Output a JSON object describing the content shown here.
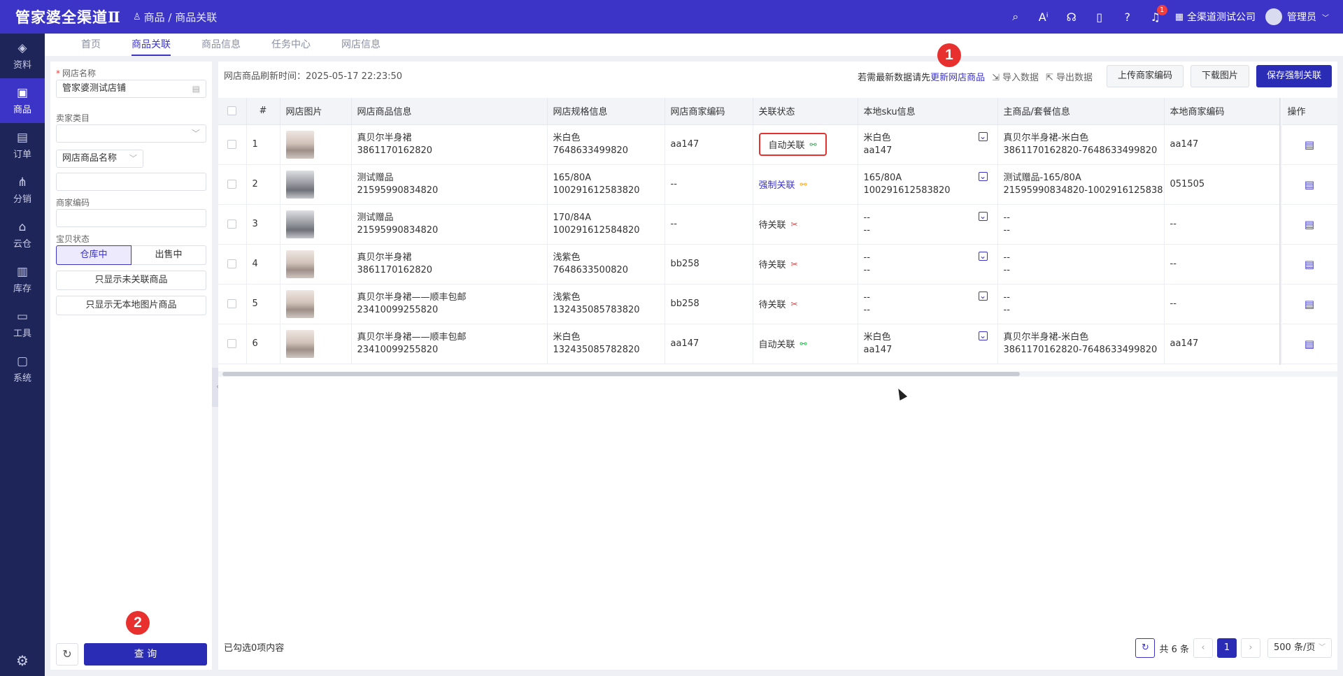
{
  "app": {
    "logo": "管家婆全渠道Ⅱ",
    "breadcrumb": "商品 / 商品关联"
  },
  "topbar": {
    "company": "全渠道测试公司",
    "user": "管理员",
    "notification_count": "1"
  },
  "sidebar": {
    "items": [
      {
        "label": "资料",
        "icon": "layers-icon"
      },
      {
        "label": "商品",
        "icon": "box-icon",
        "active": true
      },
      {
        "label": "订单",
        "icon": "document-icon"
      },
      {
        "label": "分销",
        "icon": "network-icon"
      },
      {
        "label": "云仓",
        "icon": "house-icon"
      },
      {
        "label": "库存",
        "icon": "clipboard-icon"
      },
      {
        "label": "工具",
        "icon": "toolbox-icon"
      },
      {
        "label": "系统",
        "icon": "monitor-icon"
      }
    ]
  },
  "tabs": [
    "首页",
    "商品关联",
    "商品信息",
    "任务中心",
    "网店信息"
  ],
  "filter": {
    "shop_label": "网店名称",
    "shop_value": "管家婆测试店铺",
    "category_label": "卖家类目",
    "category_value": "",
    "name_select": "网店商品名称",
    "name_value": "",
    "code_label": "商家编码",
    "code_value": "",
    "status_label": "宝贝状态",
    "status_options": [
      "仓库中",
      "出售中"
    ],
    "btn_unlinked": "只显示未关联商品",
    "btn_no_image": "只显示无本地图片商品",
    "query": "查 询"
  },
  "toolbar": {
    "refresh_time": "网店商品刷新时间：2025-05-17 22:23:50",
    "hint": "若需最新数据请先",
    "hint_link": "更新网店商品",
    "import": "导入数据",
    "export": "导出数据",
    "upload_code": "上传商家编码",
    "download_image": "下载图片",
    "save_force": "保存强制关联"
  },
  "table": {
    "headers": [
      "#",
      "网店图片",
      "网店商品信息",
      "网店规格信息",
      "网店商家编码",
      "关联状态",
      "本地sku信息",
      "主商品/套餐信息",
      "本地商家编码",
      "操作"
    ],
    "rows": [
      {
        "no": "1",
        "img": "light",
        "name": "真贝尔半身裙",
        "id": "3861170162820",
        "spec": "米白色",
        "spec_id": "7648633499820",
        "code": "aa147",
        "status": "自动关联",
        "status_type": "auto",
        "sku1": "米白色",
        "sku2": "aa147",
        "main1": "真贝尔半身裙-米白色",
        "main2": "3861170162820-7648633499820",
        "local": "aa147"
      },
      {
        "no": "2",
        "img": "grey",
        "name": "测试赠品",
        "id": "21595990834820",
        "spec": "165/80A",
        "spec_id": "100291612583820",
        "code": "--",
        "status": "强制关联",
        "status_type": "force",
        "sku1": "165/80A",
        "sku2": "100291612583820",
        "main1": "测试赠品-165/80A",
        "main2": "21595990834820-1002916125838...",
        "local": "051505"
      },
      {
        "no": "3",
        "img": "grey",
        "name": "测试赠品",
        "id": "21595990834820",
        "spec": "170/84A",
        "spec_id": "100291612584820",
        "code": "--",
        "status": "待关联",
        "status_type": "pending",
        "sku1": "--",
        "sku2": "--",
        "main1": "--",
        "main2": "--",
        "local": "--"
      },
      {
        "no": "4",
        "img": "light",
        "name": "真贝尔半身裙",
        "id": "3861170162820",
        "spec": "浅紫色",
        "spec_id": "7648633500820",
        "code": "bb258",
        "status": "待关联",
        "status_type": "pending",
        "sku1": "--",
        "sku2": "--",
        "main1": "--",
        "main2": "--",
        "local": "--"
      },
      {
        "no": "5",
        "img": "light",
        "name": "真贝尔半身裙——顺丰包邮",
        "id": "23410099255820",
        "spec": "浅紫色",
        "spec_id": "132435085783820",
        "code": "bb258",
        "status": "待关联",
        "status_type": "pending",
        "sku1": "--",
        "sku2": "--",
        "main1": "--",
        "main2": "--",
        "local": "--"
      },
      {
        "no": "6",
        "img": "light",
        "name": "真贝尔半身裙——顺丰包邮",
        "id": "23410099255820",
        "spec": "米白色",
        "spec_id": "132435085782820",
        "code": "aa147",
        "status": "自动关联",
        "status_type": "auto",
        "sku1": "米白色",
        "sku2": "aa147",
        "main1": "真贝尔半身裙-米白色",
        "main2": "3861170162820-7648633499820",
        "local": "aa147"
      }
    ]
  },
  "footer": {
    "selected": "已勾选0项内容",
    "total": "共 6 条",
    "page": "1",
    "page_size": "500 条/页"
  },
  "markers": [
    "1",
    "2"
  ],
  "colors": {
    "brand": "#3b34c7",
    "sidebar": "#1e2559",
    "highlight": "#e8312e"
  }
}
